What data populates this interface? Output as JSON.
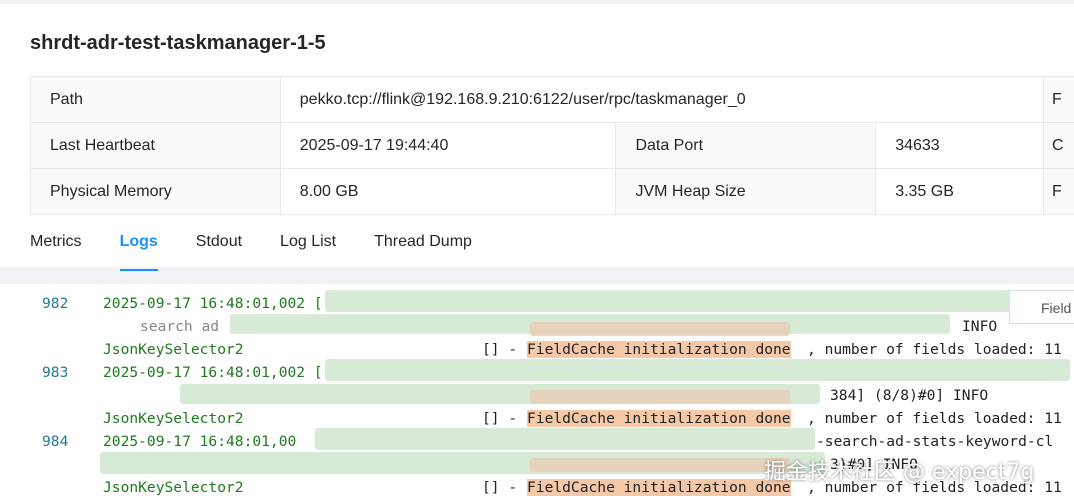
{
  "header": {
    "title": "shrdt-adr-test-taskmanager-1-5"
  },
  "info": {
    "path_label": "Path",
    "path_value": "pekko.tcp://flink@192.168.9.210:6122/user/rpc/taskmanager_0",
    "path_extra": "F",
    "heartbeat_label": "Last Heartbeat",
    "heartbeat_value": "2025-09-17 19:44:40",
    "data_port_label": "Data Port",
    "data_port_value": "34633",
    "data_port_extra": "C",
    "memory_label": "Physical Memory",
    "memory_value": "8.00 GB",
    "jvm_label": "JVM Heap Size",
    "jvm_value": "3.35 GB",
    "jvm_extra": "F"
  },
  "tabs": [
    "Metrics",
    "Logs",
    "Stdout",
    "Log List",
    "Thread Dump"
  ],
  "logs": {
    "lines": [
      {
        "num": "982",
        "date": "2025-09-17 16:48:01,002 [",
        "level": "INFO",
        "cls": "JsonKeySelector2",
        "bracket": "[] - ",
        "msg": "FieldCache initialization done",
        "tail": ", number of fields loaded: 11"
      },
      {
        "num": "983",
        "date": "2025-09-17 16:48:01,002 [",
        "mid": "384] (8/8)#0] INFO",
        "cls": "JsonKeySelector2",
        "bracket": "[] - ",
        "msg": "FieldCache initialization done",
        "tail": ", number of fields loaded: 11"
      },
      {
        "num": "984",
        "date": "2025-09-17 16:48:01,00",
        "mid": "-search-ad-stats-keyword-cl",
        "cls": "JsonKeySelector2",
        "bracket": "[] - ",
        "msg": "FieldCache initialization done",
        "tail": ", number of fields loaded: 11"
      }
    ],
    "frag_search": "search ad",
    "frag_info": "INFO",
    "frag_field": "Field",
    "frag_mid3": "3)#0] INFO"
  },
  "watermark": "掘金技术社区 @ expect7g"
}
